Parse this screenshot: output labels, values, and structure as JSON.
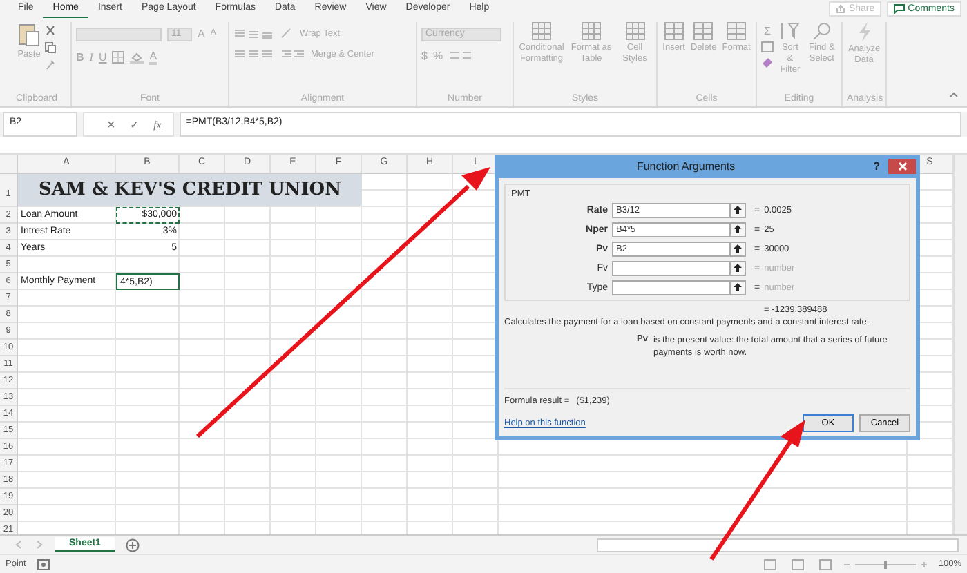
{
  "menu_tabs": [
    {
      "label": "File",
      "selected": false
    },
    {
      "label": "Home",
      "selected": true
    },
    {
      "label": "Insert",
      "selected": false
    },
    {
      "label": "Page Layout",
      "selected": false
    },
    {
      "label": "Formulas",
      "selected": false
    },
    {
      "label": "Data",
      "selected": false
    },
    {
      "label": "Review",
      "selected": false
    },
    {
      "label": "View",
      "selected": false
    },
    {
      "label": "Developer",
      "selected": false
    },
    {
      "label": "Help",
      "selected": false
    }
  ],
  "share_button": "Share",
  "comments_button": "Comments",
  "ribbon": {
    "disabled": true,
    "clipboard": {
      "paste": "Paste",
      "label": "Clipboard"
    },
    "font": {
      "size": "11",
      "grow": "A",
      "shrink": "A",
      "bold": "B",
      "italic": "I",
      "underline": "U",
      "font_color": "A",
      "label": "Font"
    },
    "alignment": {
      "wrap_text": "Wrap Text",
      "merge_center": "Merge & Center",
      "label": "Alignment"
    },
    "number": {
      "format": "Currency",
      "currency": "$",
      "percent": "%",
      "label": "Number"
    },
    "styles": {
      "buttons": [
        "Conditional Formatting",
        "Format as Table",
        "Cell Styles"
      ],
      "label": "Styles"
    },
    "cells": {
      "buttons": [
        "Insert",
        "Delete",
        "Format"
      ],
      "label": "Cells"
    },
    "editing": {
      "autosum": "Σ",
      "buttons": [
        "Sort & Filter",
        "Find & Select"
      ],
      "label": "Editing"
    },
    "analysis": {
      "buttons": [
        "Analyze Data"
      ],
      "label": "Analysis"
    }
  },
  "formula_bar": {
    "name_box": "B2",
    "cancel": "✕",
    "enter": "✓",
    "fx": "fx",
    "formula": "=PMT(B3/12,B4*5,B2)"
  },
  "sheet": {
    "columns": [
      "A",
      "B",
      "C",
      "D",
      "E",
      "F",
      "G",
      "H",
      "I",
      "S"
    ],
    "title": "SAM & KEV'S CREDIT UNION",
    "rows": [
      {
        "number": "1",
        "kind": "title"
      },
      {
        "number": "2",
        "kind": "data",
        "label": "Loan Amount",
        "value": "$30,000",
        "referenced": true,
        "active": false
      },
      {
        "number": "3",
        "kind": "data",
        "label": "Intrest Rate",
        "value": "3%",
        "referenced": false,
        "active": false
      },
      {
        "number": "4",
        "kind": "data",
        "label": "Years",
        "value": "5",
        "referenced": false,
        "active": false
      },
      {
        "number": "5",
        "kind": "blank"
      },
      {
        "number": "6",
        "kind": "data",
        "label": "Monthly Payment",
        "value": "4*5,B2)",
        "referenced": false,
        "active": true
      },
      {
        "number": "7",
        "kind": "blank"
      },
      {
        "number": "8",
        "kind": "blank"
      },
      {
        "number": "9",
        "kind": "blank"
      },
      {
        "number": "10",
        "kind": "blank"
      },
      {
        "number": "11",
        "kind": "blank"
      },
      {
        "number": "12",
        "kind": "blank"
      },
      {
        "number": "13",
        "kind": "blank"
      },
      {
        "number": "14",
        "kind": "blank"
      },
      {
        "number": "15",
        "kind": "blank"
      },
      {
        "number": "16",
        "kind": "blank"
      },
      {
        "number": "17",
        "kind": "blank"
      },
      {
        "number": "18",
        "kind": "blank"
      },
      {
        "number": "19",
        "kind": "blank"
      },
      {
        "number": "20",
        "kind": "blank"
      },
      {
        "number": "21",
        "kind": "blank"
      }
    ]
  },
  "dialog": {
    "title": "Function Arguments",
    "help": "?",
    "function": "PMT",
    "arguments": [
      {
        "name": "Rate",
        "value": "B3/12",
        "equals": "=",
        "result": "0.0025",
        "required": true
      },
      {
        "name": "Nper",
        "value": "B4*5",
        "equals": "=",
        "result": "25",
        "required": true
      },
      {
        "name": "Pv",
        "value": "B2",
        "equals": "=",
        "result": "30000",
        "required": true
      },
      {
        "name": "Fv",
        "equals": "=",
        "result": "number",
        "required": false
      },
      {
        "name": "Type",
        "equals": "=",
        "result": "number",
        "required": false
      }
    ],
    "total": "= -1239.389488",
    "description": "Calculates the payment for a loan based on constant payments and a constant interest rate.",
    "argument_help": {
      "name": "Pv",
      "text": "is the present value: the total amount that a series of future payments is worth now."
    },
    "formula_result_label": "Formula result =",
    "formula_result": "($1,239)",
    "help_link": "Help on this function",
    "ok": "OK",
    "cancel": "Cancel"
  },
  "sheet_tabs": [
    {
      "label": "Sheet1",
      "selected": true
    }
  ],
  "status_bar": {
    "mode": "Point",
    "zoom_slider": {
      "level": 0.5
    },
    "zoom": "100%"
  }
}
